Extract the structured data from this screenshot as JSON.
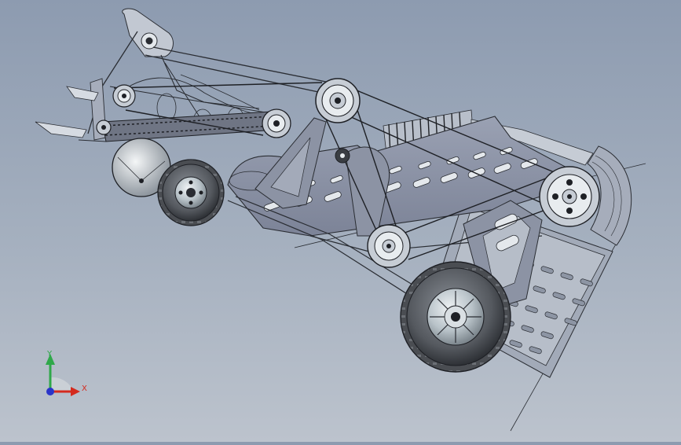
{
  "view": {
    "background_top": "#8d9bb0",
    "background_bottom": "#bcc3cd",
    "edge_color": "#2a2d33",
    "panel_color": "#8f96a8",
    "tyre_color": "#4b4e53",
    "rim_color": "#c9d1d6"
  },
  "triad": {
    "x_label": "X",
    "y_label": "Y",
    "x_color": "#d42a1e",
    "y_color": "#2fa84a",
    "z_color": "#2a34c9"
  }
}
